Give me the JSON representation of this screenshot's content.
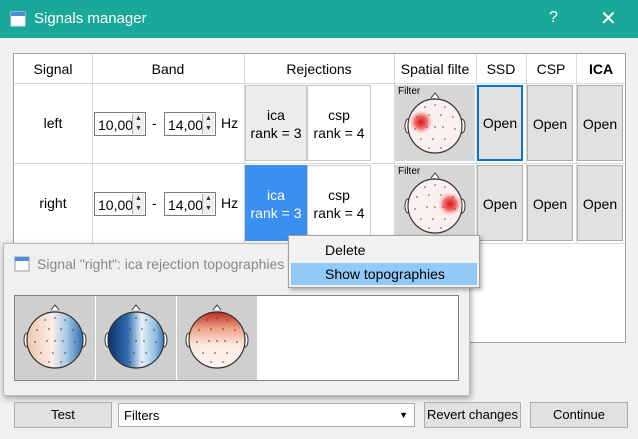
{
  "window": {
    "title": "Signals manager",
    "help": "?",
    "close": "✕"
  },
  "headers": {
    "signal": "Signal",
    "band": "Band",
    "rejections": "Rejections",
    "spatial": "Spatial filte",
    "ssd": "SSD",
    "csp": "CSP",
    "ica": "ICA"
  },
  "rows": [
    {
      "label": "left",
      "low": "10,00",
      "high": "14,00",
      "dash": "-",
      "unit": "Hz",
      "rej1_type": "ica",
      "rej1_rank": "rank = 3",
      "rej2_type": "csp",
      "rej2_rank": "rank = 4",
      "filter_label": "Filter",
      "open_ssd": "Open",
      "open_csp": "Open",
      "open_ica": "Open"
    },
    {
      "label": "right",
      "low": "10,00",
      "high": "14,00",
      "dash": "-",
      "unit": "Hz",
      "rej1_type": "ica",
      "rej1_rank": "rank = 3",
      "rej2_type": "csp",
      "rej2_rank": "rank = 4",
      "filter_label": "Filter",
      "open_ssd": "Open",
      "open_csp": "Open",
      "open_ica": "Open"
    }
  ],
  "context_menu": {
    "delete": "Delete",
    "show": "Show topographies"
  },
  "popup": {
    "title": "Signal \"right\": ica rejection topographies"
  },
  "bottom": {
    "test": "Test",
    "filters": "Filters",
    "revert": "Revert changes",
    "continue": "Continue"
  },
  "icons": {
    "app": "signals-icon",
    "spin_up": "▲",
    "spin_down": "▼",
    "combo_arrow": "▼"
  },
  "colors": {
    "titlebar": "#1aa89a",
    "selection": "#3b8ff0",
    "menu_highlight": "#91c9f7",
    "focus": "#0078d7"
  }
}
